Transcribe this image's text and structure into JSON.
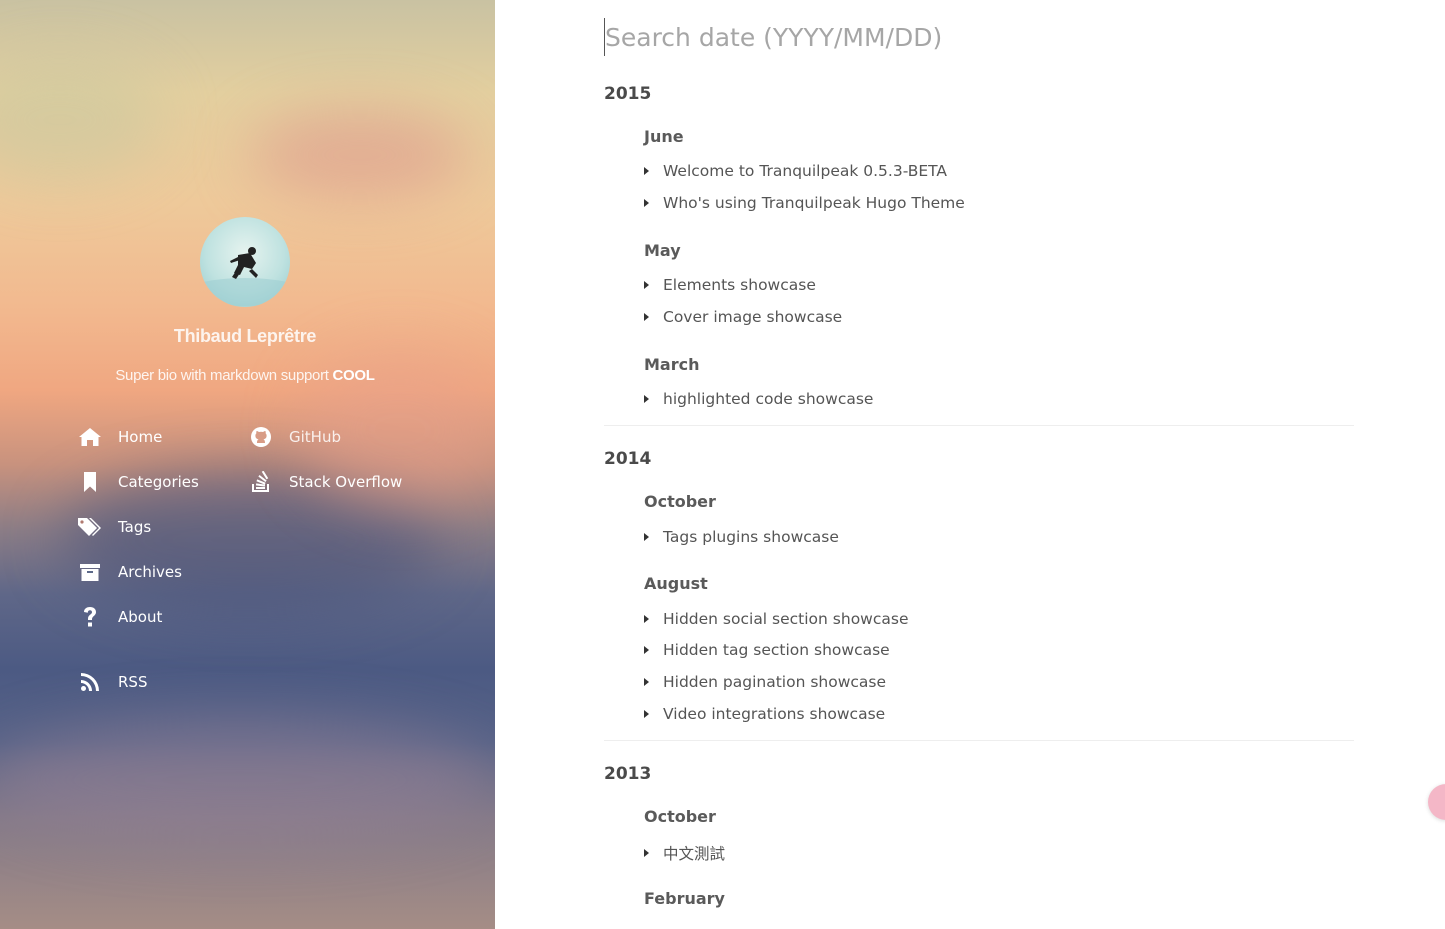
{
  "sidebar": {
    "author_name": "Thibaud Leprêtre",
    "author_bio_text": "Super bio with markdown support ",
    "author_bio_bold": "COOL",
    "nav_left": [
      {
        "label": "Home",
        "icon": "home-icon"
      },
      {
        "label": "Categories",
        "icon": "bookmark-icon"
      },
      {
        "label": "Tags",
        "icon": "tags-icon"
      },
      {
        "label": "Archives",
        "icon": "archive-icon"
      },
      {
        "label": "About",
        "icon": "question-icon"
      },
      {
        "label": "RSS",
        "icon": "rss-icon"
      }
    ],
    "nav_right": [
      {
        "label": "GitHub",
        "icon": "github-icon"
      },
      {
        "label": "Stack Overflow",
        "icon": "stack-overflow-icon"
      }
    ]
  },
  "search": {
    "placeholder": "Search date (YYYY/MM/DD)"
  },
  "archives": [
    {
      "year": "2015",
      "months": [
        {
          "name": "June",
          "posts": [
            "Welcome to Tranquilpeak 0.5.3-BETA",
            "Who's using Tranquilpeak Hugo Theme"
          ]
        },
        {
          "name": "May",
          "posts": [
            "Elements showcase",
            "Cover image showcase"
          ]
        },
        {
          "name": "March",
          "posts": [
            "highlighted code showcase"
          ]
        }
      ]
    },
    {
      "year": "2014",
      "months": [
        {
          "name": "October",
          "posts": [
            "Tags plugins showcase"
          ]
        },
        {
          "name": "August",
          "posts": [
            "Hidden social section showcase",
            "Hidden tag section showcase",
            "Hidden pagination showcase",
            "Video integrations showcase"
          ]
        }
      ]
    },
    {
      "year": "2013",
      "months": [
        {
          "name": "October",
          "posts": [
            "中文測試"
          ]
        },
        {
          "name": "February",
          "posts": []
        }
      ]
    }
  ],
  "colors": {
    "float_button": "#f4b7c7",
    "text": "#555555"
  }
}
